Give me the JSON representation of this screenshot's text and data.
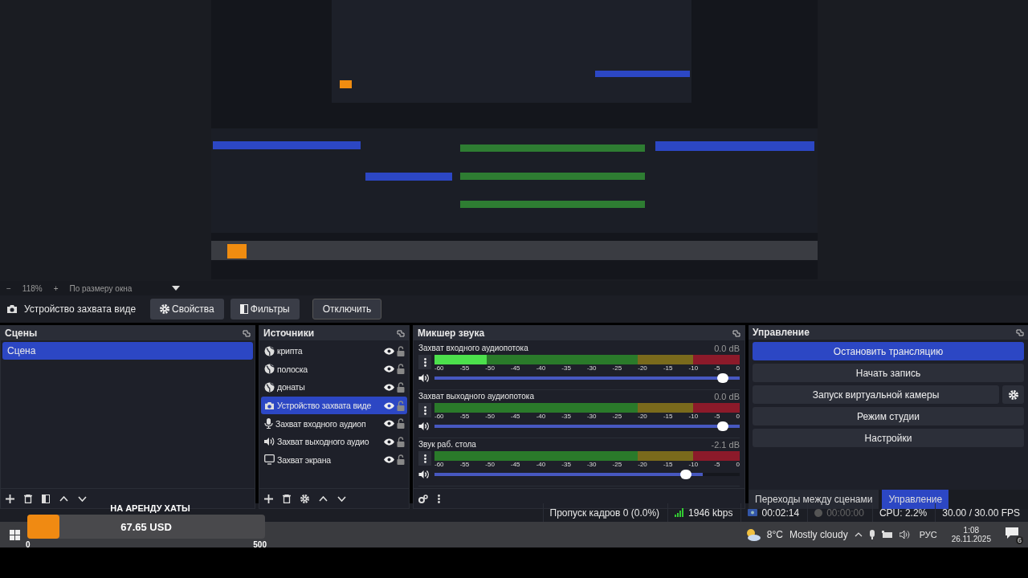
{
  "zoom_bar": {
    "minus": "−",
    "zoom": "118%",
    "plus": "+",
    "fit": "По размеру окна"
  },
  "source_toolbar": {
    "source": "Устройство захвата виде",
    "buttons": [
      {
        "label": "Свойства",
        "kind": "gear"
      },
      {
        "label": "Фильтры",
        "kind": "filter"
      },
      {
        "label": "Отключить",
        "kind": "outlined"
      }
    ]
  },
  "scenes": {
    "title": "Сцены",
    "items": [
      {
        "name": "Сцена",
        "selected": true
      }
    ]
  },
  "sources": {
    "title": "Источники",
    "items": [
      {
        "name": "крипта",
        "kind": "browser",
        "selected": false,
        "visible": true,
        "locked": false
      },
      {
        "name": "полоска",
        "kind": "browser",
        "selected": false,
        "visible": true,
        "locked": false
      },
      {
        "name": "донаты",
        "kind": "browser",
        "selected": false,
        "visible": true,
        "locked": false
      },
      {
        "name": "Устройство захвата виде",
        "kind": "camera",
        "selected": true,
        "visible": true,
        "locked": false
      },
      {
        "name": "Захват входного аудиоп",
        "kind": "mic",
        "selected": false,
        "visible": true,
        "locked": false
      },
      {
        "name": "Захват выходного аудио",
        "kind": "speaker",
        "selected": false,
        "visible": true,
        "locked": false
      },
      {
        "name": "Захват экрана",
        "kind": "monitor",
        "selected": false,
        "visible": true,
        "locked": false
      }
    ]
  },
  "mixer": {
    "title": "Микшер звука",
    "channels": [
      {
        "name": "Захват входного аудиопотока",
        "reading": "0.0 dB",
        "meter": {
          "level": 0.17
        },
        "volume": {
          "level": 1
        },
        "scale": [
          "-60",
          "-55",
          "-50",
          "-45",
          "-40",
          "-35",
          "-30",
          "-25",
          "-20",
          "-15",
          "-10",
          "-5",
          "0"
        ]
      },
      {
        "name": "Захват выходного аудиопотока",
        "reading": "0.0 dB",
        "meter": {
          "level": 0
        },
        "volume": {
          "level": 1
        },
        "scale": [
          "-60",
          "-55",
          "-50",
          "-45",
          "-40",
          "-35",
          "-30",
          "-25",
          "-20",
          "-15",
          "-10",
          "-5",
          "0"
        ]
      },
      {
        "name": "Звук раб. стола",
        "reading": "-2.1 dB",
        "meter": {
          "level": 0
        },
        "volume": {
          "level": 0.88
        },
        "scale": [
          "-60",
          "-55",
          "-50",
          "-45",
          "-40",
          "-35",
          "-30",
          "-25",
          "-20",
          "-15",
          "-10",
          "-5",
          "0"
        ]
      }
    ]
  },
  "controls": {
    "title": "Управление",
    "buttons": [
      {
        "label": "Остановить трансляцию",
        "active": true,
        "gear": false
      },
      {
        "label": "Начать запись",
        "active": false,
        "gear": false
      },
      {
        "label": "Запуск виртуальной камеры",
        "active": false,
        "gear": true
      },
      {
        "label": "Режим студии",
        "active": false,
        "gear": false
      },
      {
        "label": "Настройки",
        "active": false,
        "gear": false
      }
    ],
    "tabs": [
      {
        "label": "Переходы между сценами",
        "selected": false
      },
      {
        "label": "Управление",
        "selected": true
      }
    ]
  },
  "status_bar": {
    "dropped": "Пропуск кадров 0 (0.0%)",
    "bitrate": "1946 kbps",
    "stream_time": "00:02:14",
    "record_time": "00:00:00",
    "cpu": "CPU: 2.2%",
    "fps": "30.00 / 30.00 FPS"
  },
  "donation_widget": {
    "title": "НА АРЕНДУ ХАТЫ",
    "amount": "67.65 USD",
    "level": 0.135,
    "min": "0",
    "max": "500"
  },
  "taskbar": {
    "temperature": "8°C",
    "weather": "Mostly cloudy",
    "language": "РУС",
    "time": "1:08",
    "date": "26.11.2025",
    "notifications": "6"
  }
}
